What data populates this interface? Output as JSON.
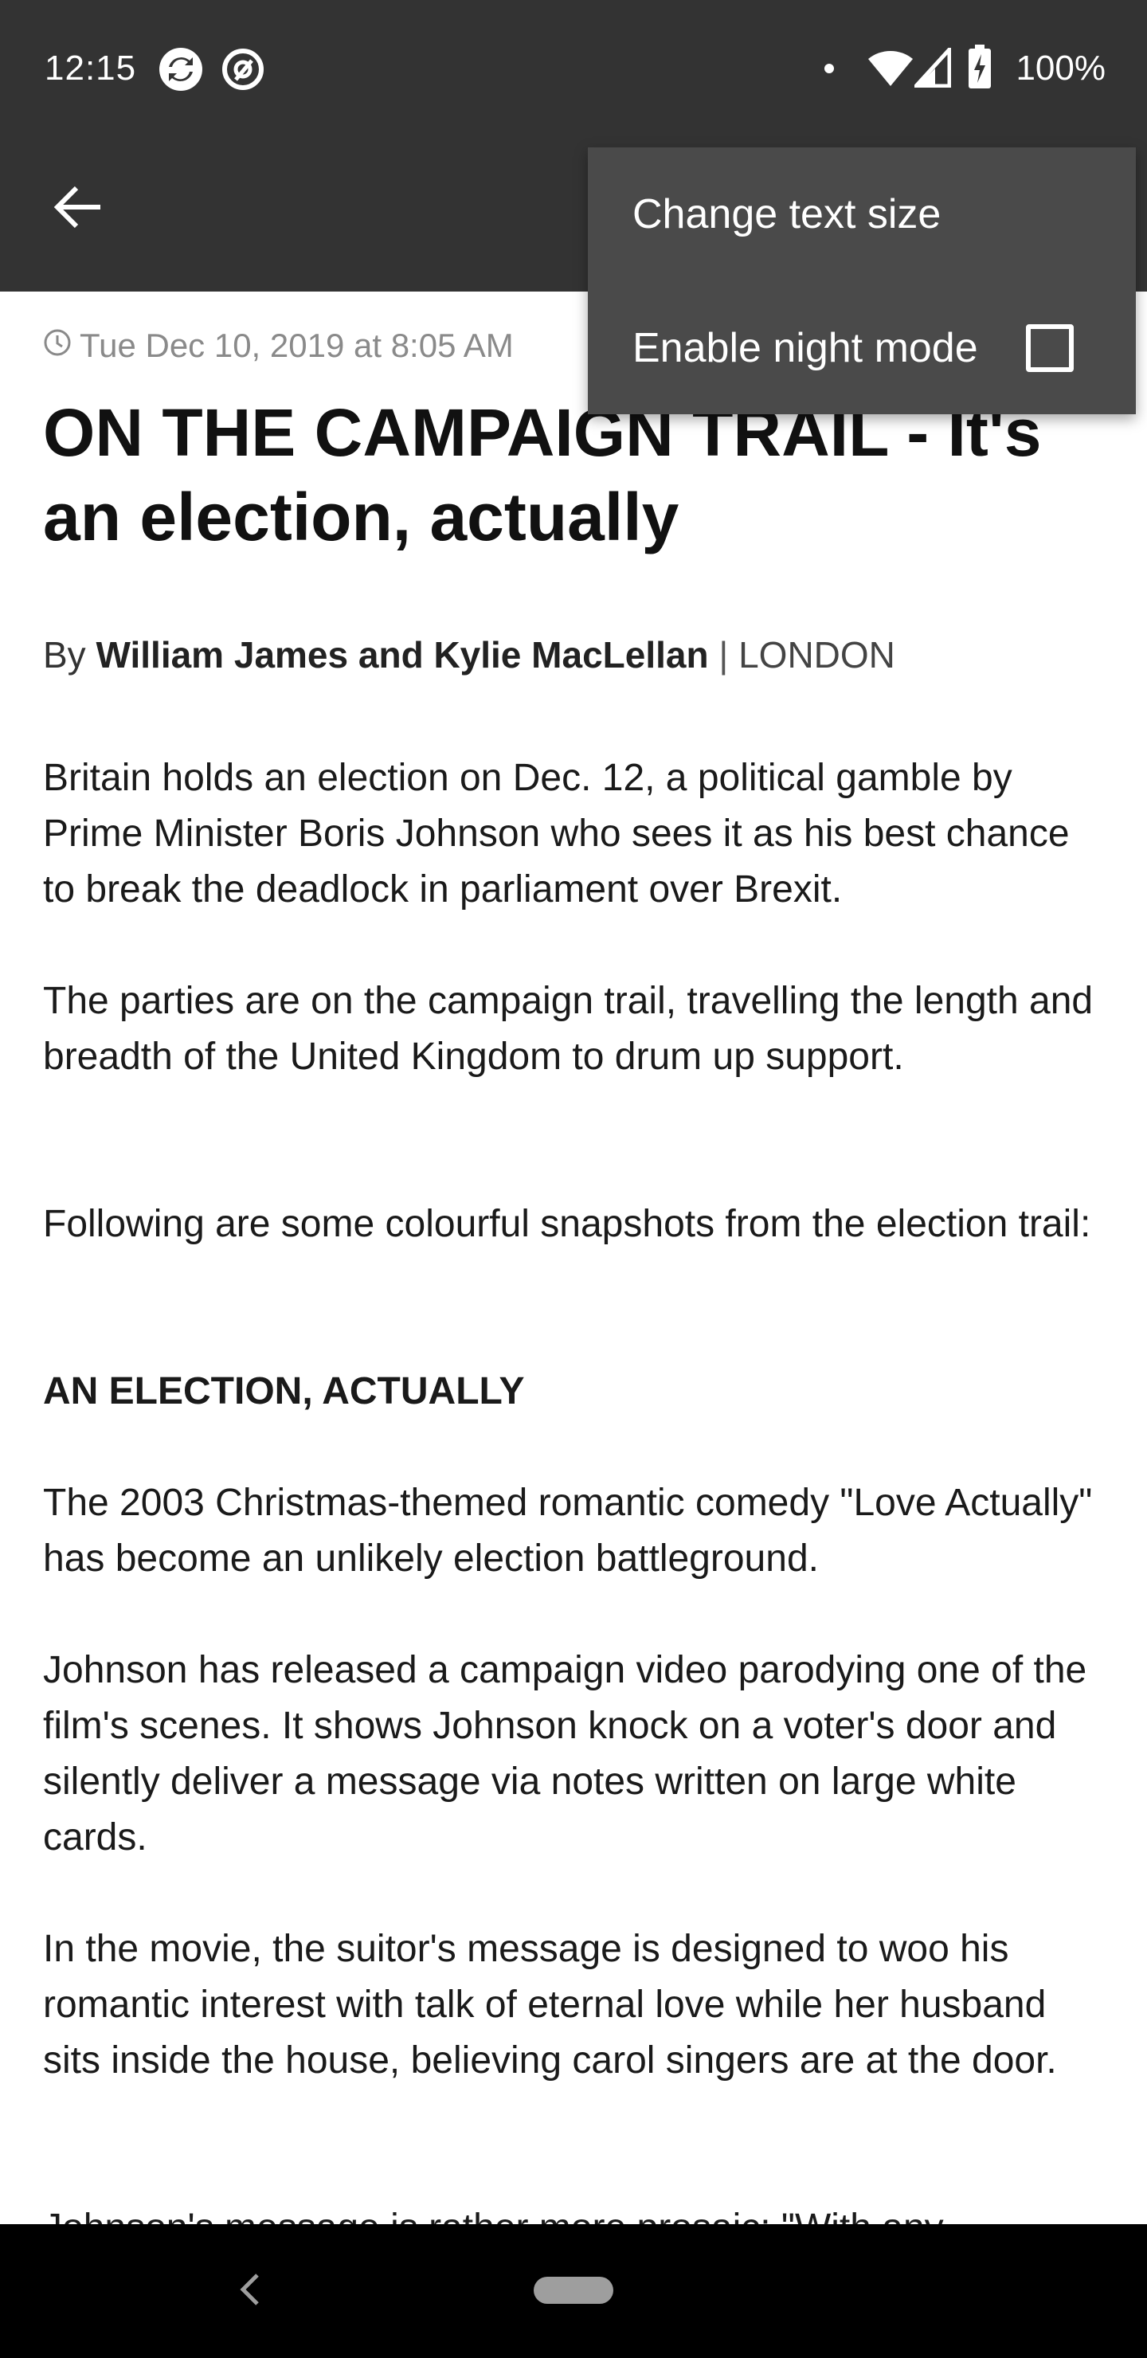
{
  "status_bar": {
    "time": "12:15",
    "battery": "100%",
    "icons": [
      "sync-icon",
      "vpn-at-icon",
      "notification-dot-icon",
      "wifi-icon",
      "cell-signal-icon",
      "battery-charging-icon"
    ]
  },
  "app_bar": {
    "back_icon": "arrow-back-icon"
  },
  "overflow_menu": {
    "items": [
      {
        "label": "Change text size"
      },
      {
        "label": "Enable night mode",
        "checked": false
      }
    ]
  },
  "article": {
    "date": "Tue Dec 10, 2019 at 8:05 AM",
    "headline": "ON THE CAMPAIGN TRAIL - It's an election, actually",
    "byline_prefix": "By",
    "authors": "William James and Kylie MacLellan",
    "separator": "|",
    "location": "LONDON",
    "paragraphs": [
      "Britain holds an election on Dec. 12, a political gamble by Prime Minister Boris Johnson who sees it as his best chance to break the deadlock in parliament over Brexit.",
      "The parties are on the campaign trail, travelling the length and breadth of the United Kingdom to drum up support.",
      "Following are some colourful snapshots from the election trail:",
      "The 2003 Christmas-themed romantic comedy \"Love Actually\" has become an unlikely election battleground.",
      "Johnson has released a campaign video parodying one of the film's scenes. It shows Johnson knock on a voter's door and silently deliver a message via notes written on large white cards.",
      "In the movie, the suitor's message is designed to woo his romantic interest with talk of eternal love while her husband sits inside the house, believing carol singers are at the door.",
      "Johnson's message is rather more prosaic: \"With any"
    ],
    "subhead": "AN ELECTION, ACTUALLY"
  },
  "colors": {
    "bar_background": "#333333",
    "menu_background": "#4a4a4a",
    "nav_background": "#000000"
  }
}
